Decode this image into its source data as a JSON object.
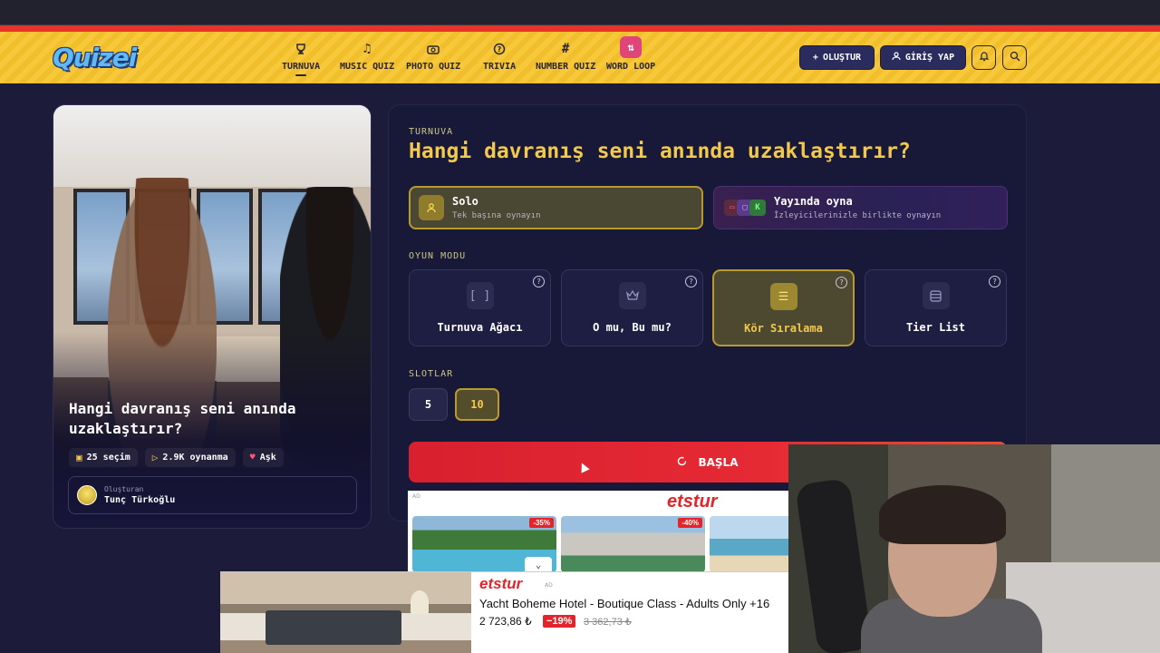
{
  "brand": {
    "logo_text": "Quizei"
  },
  "nav": {
    "items": [
      {
        "label": "TURNUVA",
        "icon": "trophy-icon",
        "active": true
      },
      {
        "label": "MUSIC QUIZ",
        "icon": "music-note-icon",
        "active": false
      },
      {
        "label": "PHOTO QUIZ",
        "icon": "camera-icon",
        "active": false
      },
      {
        "label": "TRIVIA",
        "icon": "question-bubble-icon",
        "active": false
      },
      {
        "label": "NUMBER QUIZ",
        "icon": "hash-icon",
        "active": false
      },
      {
        "label": "WORD LOOP",
        "icon": "sort-arrows-icon",
        "active": false
      }
    ],
    "create_label": "OLUŞTUR",
    "login_label": "GİRİŞ YAP"
  },
  "quiz_card": {
    "title": "Hangi davranış seni anında uzaklaştırır?",
    "stats": {
      "choices": "25 seçim",
      "plays": "2.9K oynanma",
      "category": "Aşk"
    },
    "creator_label": "Oluşturan",
    "creator_name": "Tunç Türkoğlu"
  },
  "panel": {
    "kicker": "TURNUVA",
    "title": "Hangi davranış seni anında uzaklaştırır?",
    "play_modes": {
      "solo": {
        "title": "Solo",
        "subtitle": "Tek başına oynayın"
      },
      "stream": {
        "title": "Yayında oyna",
        "subtitle": "İzleyicilerinizle birlikte oynayın"
      }
    },
    "game_mode_label": "OYUN MODU",
    "game_modes": [
      {
        "label": "Turnuva Ağacı",
        "icon": "bracket-icon",
        "active": false
      },
      {
        "label": "O mu, Bu mu?",
        "icon": "crown-icon",
        "active": false
      },
      {
        "label": "Kör Sıralama",
        "icon": "ranked-list-icon",
        "active": true
      },
      {
        "label": "Tier List",
        "icon": "list-box-icon",
        "active": false
      }
    ],
    "slots_label": "SLOTLAR",
    "slots": [
      "5",
      "10"
    ],
    "selected_slot": "10",
    "start_label": "BAŞLA"
  },
  "ads": {
    "ad_tag": "AD",
    "brand": "etstur",
    "discounts": [
      "-35%",
      "-40%"
    ],
    "banner": {
      "hotel": "Yacht Boheme Hotel - Boutique Class - Adults Only +16",
      "price": "2 723,86 ₺",
      "discount": "−19%",
      "old_price": "3 362,73 ₺"
    }
  },
  "colors": {
    "accent_yellow": "#f2c94c",
    "nav_bg": "#f6c83a",
    "start_red": "#e62a34",
    "page_bg": "#1c1c3a"
  }
}
